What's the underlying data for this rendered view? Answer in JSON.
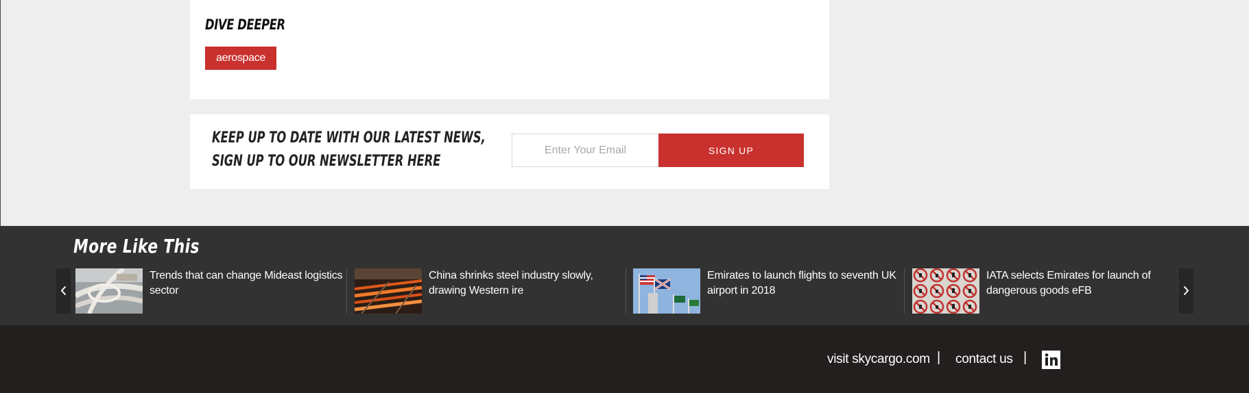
{
  "dive_deeper": {
    "title": "DIVE DEEPER",
    "tags": [
      "aerospace"
    ]
  },
  "newsletter": {
    "line1": "KEEP UP TO DATE WITH OUR LATEST NEWS,",
    "line2": "SIGN UP TO OUR NEWSLETTER HERE",
    "email_placeholder": "Enter Your Email",
    "email_value": "",
    "signup_label": "SIGN UP"
  },
  "more_like_this": {
    "title": "More Like This",
    "items": [
      {
        "caption": "Trends that can change Mideast logistics sector",
        "thumb": "highway-interchange-image"
      },
      {
        "caption": "China shrinks steel industry slowly, drawing Western ire",
        "thumb": "steel-mill-image"
      },
      {
        "caption": "Emirates to launch flights to seventh UK airport in 2018",
        "thumb": "flags-image"
      },
      {
        "caption": "IATA selects Emirates for launch of dangerous goods eFB",
        "thumb": "dangerous-goods-symbols-image"
      }
    ]
  },
  "footer": {
    "visit_label": "visit skycargo.com",
    "separator": "|",
    "contact_label": "contact us",
    "social_icon": "linkedin-icon"
  },
  "colors": {
    "accent": "#c8312e",
    "strip_bg": "#323232",
    "footer_bg": "#231f1e",
    "page_bg": "#eeeeee"
  }
}
